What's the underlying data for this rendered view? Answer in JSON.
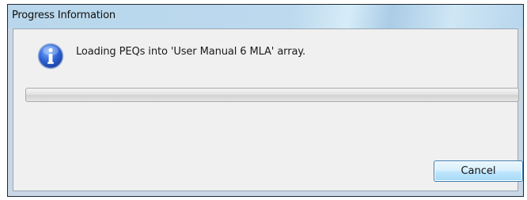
{
  "window": {
    "title": "Progress Information"
  },
  "dialog": {
    "icon": "information-icon",
    "message": "Loading PEQs into 'User Manual 6 MLA' array.",
    "progress": 0
  },
  "buttons": {
    "cancel_label": "Cancel"
  },
  "colors": {
    "titlebar": "#bcd9ee",
    "client_background": "#f0f0f0",
    "icon_blue": "#1f4fb4",
    "button_border": "#3c7fb1"
  }
}
